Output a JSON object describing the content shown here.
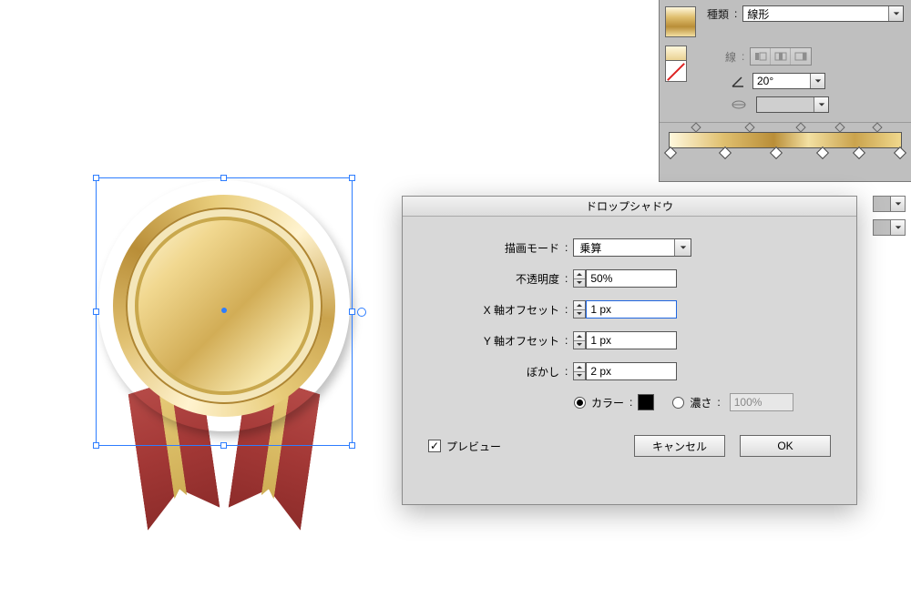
{
  "gradient_panel": {
    "type_label": "種類",
    "type_value": "線形",
    "stroke_label": "線",
    "angle_value": "20°"
  },
  "dialog": {
    "title": "ドロップシャドウ",
    "mode_label": "描画モード",
    "mode_value": "乗算",
    "opacity_label": "不透明度",
    "opacity_value": "50%",
    "x_offset_label": "X 軸オフセット",
    "x_offset_value": "1 px",
    "y_offset_label": "Y 軸オフセット",
    "y_offset_value": "1 px",
    "blur_label": "ぼかし",
    "blur_value": "2 px",
    "color_label": "カラー",
    "darkness_label": "濃さ",
    "darkness_value": "100%",
    "preview_label": "プレビュー",
    "cancel_label": "キャンセル",
    "ok_label": "OK",
    "colon": ":"
  }
}
